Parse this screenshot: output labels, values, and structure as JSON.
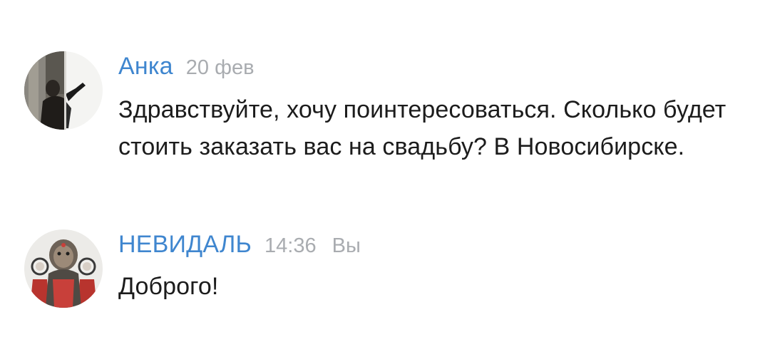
{
  "colors": {
    "author": "#3f86cf",
    "meta": "#a9acb0",
    "text": "#1c1c1c",
    "background": "#ffffff"
  },
  "messages": [
    {
      "author": "Анка",
      "date": "20 фев",
      "you_label": "",
      "avatar_icon": "user-photo-avatar-icon",
      "text": "Здравствуйте, хочу поинтересоваться. Сколько будет стоить заказать вас на свадьбу? В Новосибирске."
    },
    {
      "author": "НЕВИДАЛЬ",
      "date": "14:36",
      "you_label": "Вы",
      "avatar_icon": "group-logo-avatar-icon",
      "text": "Доброго!"
    }
  ]
}
